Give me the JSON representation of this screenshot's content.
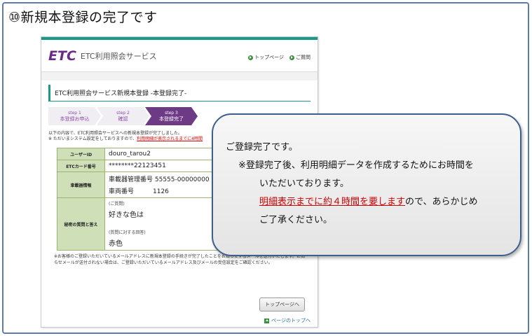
{
  "slide": {
    "title": "⑩新規本登録の完了です"
  },
  "header": {
    "logo": "ETC",
    "brand": "ETC利用照会サービス",
    "links": [
      "トップページ",
      "ご質問"
    ]
  },
  "page": {
    "heading": "ETC利用照会サービス新規本登録 -本登録完了-",
    "steps": [
      {
        "num": "step 1",
        "label": "本登録お申込"
      },
      {
        "num": "step 2",
        "label": "確認"
      },
      {
        "num": "step 3",
        "label": "本登録完了"
      }
    ],
    "note_line1": "以下の内容で、ETC利用照会サービスへの新規本登録が完了しました。",
    "note_line2_prefix": "※ ただいまシステム設定をしておりますので、",
    "note_line2_red": "利用明細が表示されるまでに4時間",
    "table": {
      "user_id_label": "ユーザーID",
      "user_id": "douro_tarou2",
      "card_label": "ETCカード番号",
      "card": "********22123451",
      "vehicle_label": "車載器情報",
      "vehicle_mgmt": "車載器管理番号 55555-00000000",
      "vehicle_num": "車両番号　　　1126",
      "secret_label": "秘密の質問と答え",
      "q_caption": "(ご質問)",
      "question": "好きな色は",
      "a_caption": "(質問に対する回答)",
      "answer": "赤色"
    },
    "foot_line1": "※お客様のご登録いただいているメールアドレスに新規本登録の手続きが完了したことをお知らせするメールを送付いたします。お知",
    "foot_line2": "らせメールが送付されない場合は、ご登録いただいているメールアドレス及びメールの受信設定をご確認ください。",
    "top_button": "トップページへ",
    "page_top": "ページのトップへ"
  },
  "callout": {
    "line1": "ご登録完了です。",
    "line2": "※登録完了後、利用明細データを作成するためにお時間を",
    "line3": "いただいております。",
    "line4_red": "明細表示までに約４時間を要します",
    "line4_rest": "ので、あらかじめ",
    "line5": "ご了承ください。"
  }
}
